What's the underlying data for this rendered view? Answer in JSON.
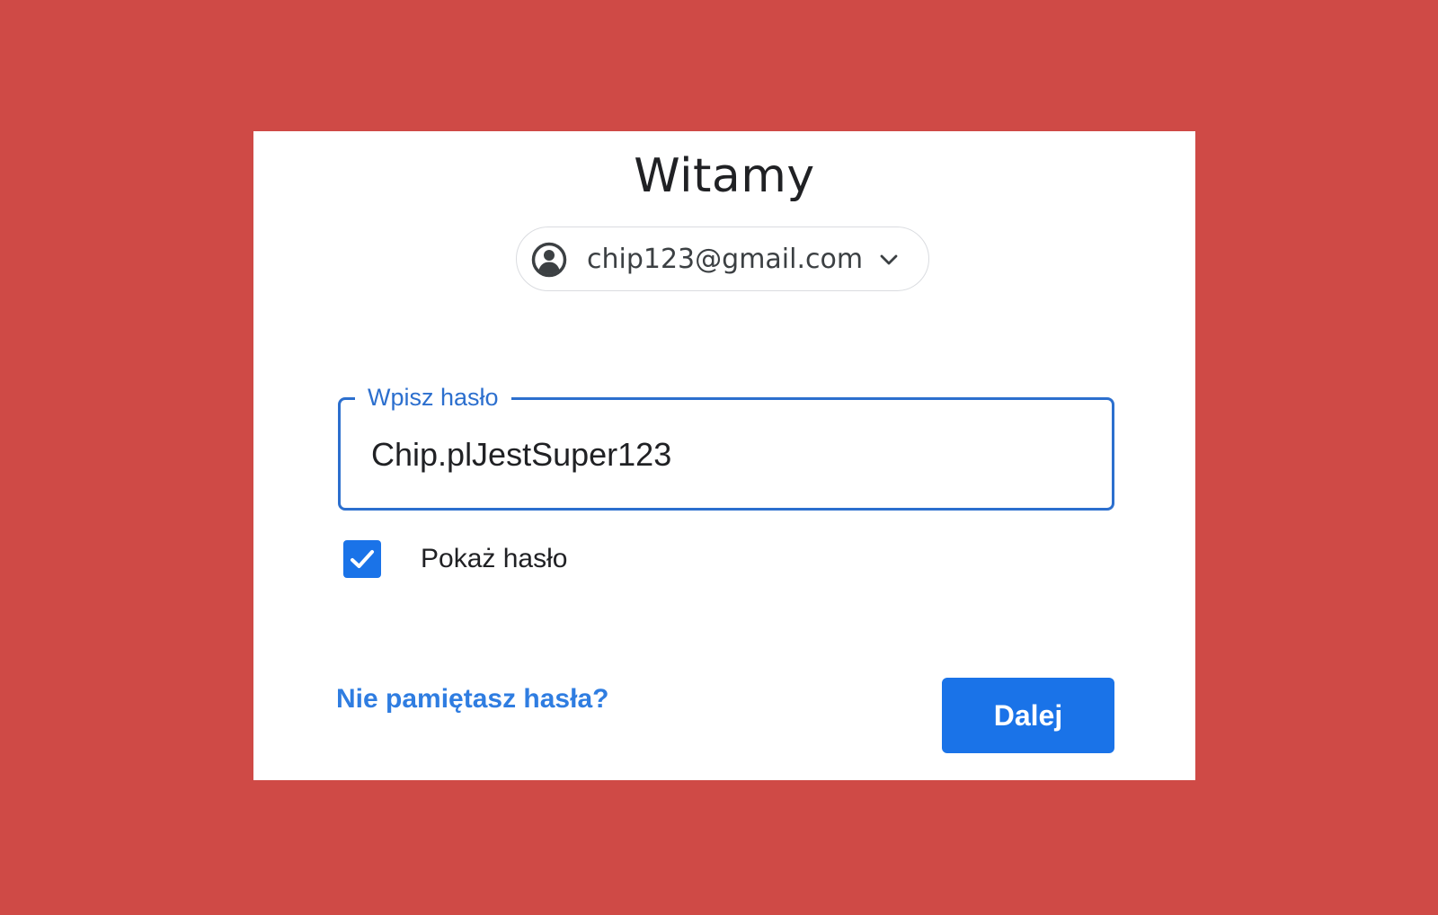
{
  "page": {
    "title": "Witamy"
  },
  "account": {
    "email": "chip123@gmail.com",
    "avatar_icon": "account-circle-icon",
    "chevron_icon": "chevron-down-icon"
  },
  "password_field": {
    "label": "Wpisz hasło",
    "value": "Chip.plJestSuper123"
  },
  "show_password": {
    "label": "Pokaż hasło",
    "checked": true,
    "icon": "checkmark-icon"
  },
  "actions": {
    "forgot_label": "Nie pamiętasz hasła?",
    "next_label": "Dalej"
  },
  "colors": {
    "background": "#cf4a46",
    "accent": "#1a73e8",
    "link": "#2f7de1"
  }
}
